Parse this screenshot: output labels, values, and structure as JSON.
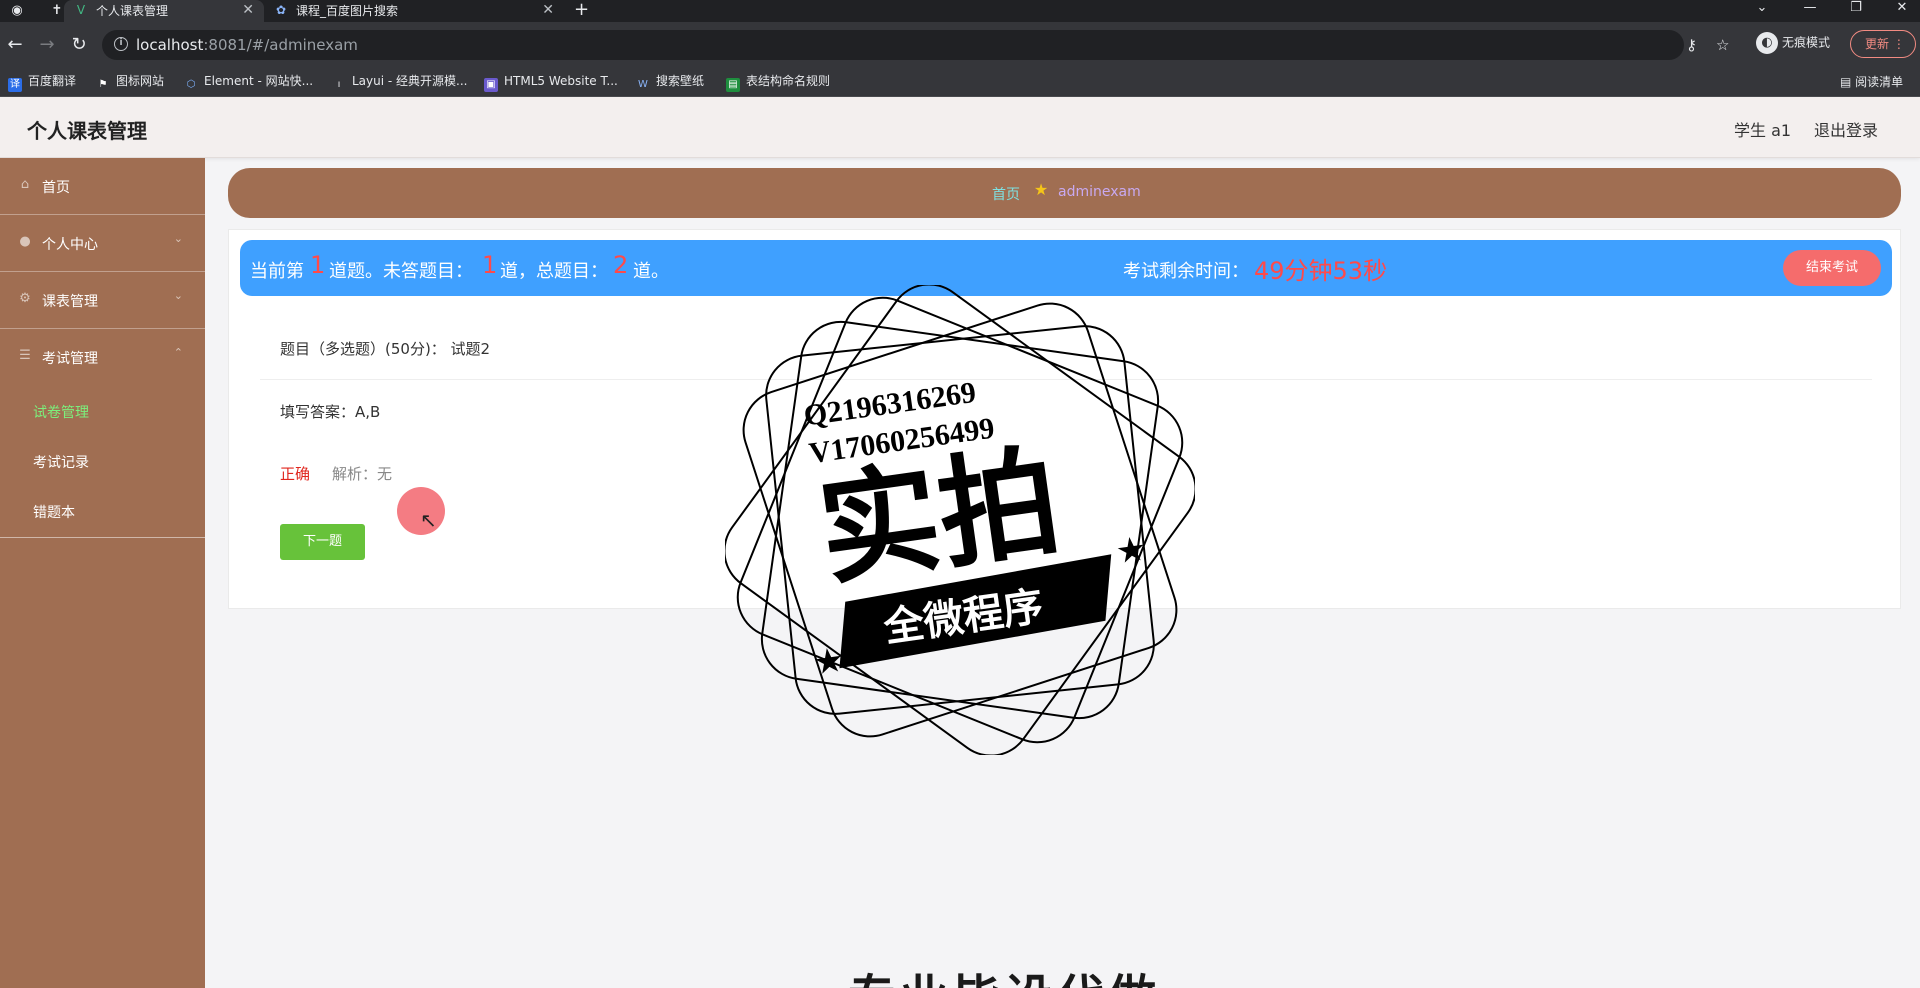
{
  "browser": {
    "tabs": [
      {
        "title": "个人课表管理",
        "active": true
      },
      {
        "title": "课程_百度图片搜索",
        "active": false
      }
    ],
    "new_tab": "+",
    "url_host": "localhost",
    "url_path": ":8081/#/adminexam",
    "incognito_label": "无痕模式",
    "update_label": "更新",
    "bookmarks": [
      "百度翻译",
      "图标网站",
      "Element - 网站快...",
      "Layui - 经典开源模...",
      "HTML5 Website T...",
      "搜索壁纸",
      "表结构命名规则"
    ],
    "reading_list": "阅读清单"
  },
  "header": {
    "title": "个人课表管理",
    "user": "学生 a1",
    "logout": "退出登录"
  },
  "sidebar": {
    "items": [
      {
        "label": "首页",
        "icon": "home-icon"
      },
      {
        "label": "个人中心",
        "icon": "user-icon"
      },
      {
        "label": "课表管理",
        "icon": "schedule-icon"
      },
      {
        "label": "考试管理",
        "icon": "exam-icon"
      }
    ],
    "sub_items": [
      {
        "label": "试卷管理",
        "active": true
      },
      {
        "label": "考试记录",
        "active": false
      },
      {
        "label": "错题本",
        "active": false
      }
    ]
  },
  "breadcrumb": {
    "home": "首页",
    "current": "adminexam"
  },
  "exam": {
    "status_prefix": "当前第",
    "current_index": "1",
    "status_mid": "道题。未答题目：",
    "unanswered": "1",
    "status_mid2": "道，总题目：",
    "total": "2",
    "status_suffix": "道。",
    "time_label": "考试剩余时间：",
    "time_remaining": "49分钟53秒",
    "end_button": "结束考试",
    "question_title": "题目（多选题）(50分)：  试题2",
    "answer": "填写答案：A,B",
    "result": "正确",
    "analysis": "解析：无",
    "next_button": "下一题"
  },
  "watermark": {
    "line1": "Q2196316269",
    "line2": "V17060256499",
    "main": "实拍",
    "banner": "全微程序"
  },
  "bottom_text": "专业毕设代做",
  "colors": {
    "sidebar_bg": "#a06e52",
    "status_bg": "#3fa0ff",
    "accent_red": "#ff4a4a",
    "next_button": "#67c23a",
    "end_button": "#f56c6c"
  }
}
